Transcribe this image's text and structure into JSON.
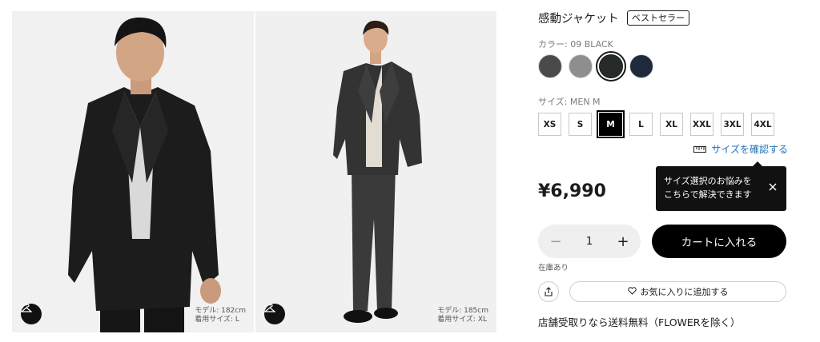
{
  "gallery": {
    "photo1_caption": [
      "モデル: 182cm",
      "着用サイズ: L"
    ],
    "photo2_caption": [
      "モデル: 185cm",
      "着用サイズ: XL"
    ],
    "fit_icon": "hanger-icon"
  },
  "product": {
    "title": "感動ジャケット",
    "badge": "ベストセラー",
    "color_label": "カラー: 09 BLACK",
    "swatches": [
      {
        "name": "dark-gray",
        "hex": "#4a4a4a"
      },
      {
        "name": "gray",
        "hex": "#8e8e8e"
      },
      {
        "name": "black",
        "hex": "#262a2a",
        "selected": true
      },
      {
        "name": "navy",
        "hex": "#1f2a3c"
      }
    ],
    "size_label": "サイズ: MEN M",
    "sizes": [
      "XS",
      "S",
      "M",
      "L",
      "XL",
      "XXL",
      "3XL",
      "4XL"
    ],
    "selected_size": "M",
    "size_link": "サイズを確認する",
    "tooltip_line1": "サイズ選択のお悩みを",
    "tooltip_line2": "こちらで解決できます",
    "price": "¥6,990",
    "quantity": "1",
    "cart_label": "カートに入れる",
    "stock": "在庫あり",
    "favorite_label": "お気に入りに追加する",
    "store_note": "店舗受取りなら送料無料（FLOWERを除く）"
  },
  "colors": {
    "link": "#1f6fb4",
    "primary": "#000000"
  }
}
